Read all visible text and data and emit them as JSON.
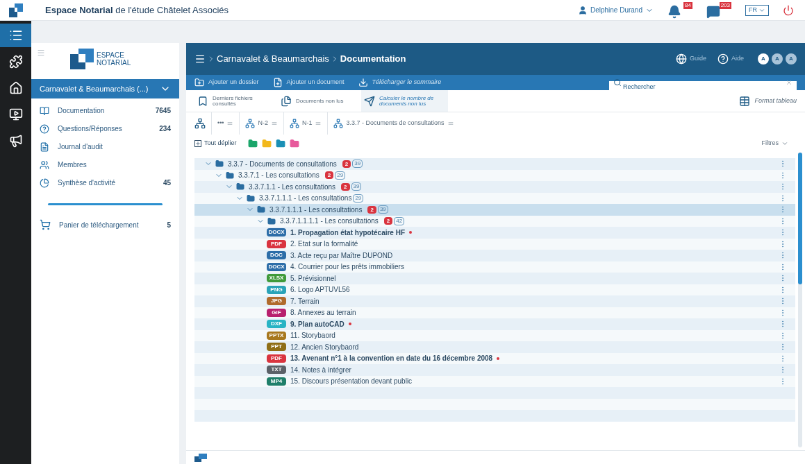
{
  "topbar": {
    "title": "**Espace Notarial** de l'étude Châtelet Associés",
    "user": "Delphine Durand",
    "notifications": "84",
    "messages": "203",
    "language": "FR"
  },
  "rail": [
    {
      "kind": "list",
      "selected": true
    },
    {
      "kind": "puzzle",
      "selected": false
    },
    {
      "kind": "home",
      "selected": false
    },
    {
      "kind": "screen",
      "selected": false
    },
    {
      "kind": "megaphone",
      "selected": false
    }
  ],
  "sidebar": {
    "logo": [
      "ESPACE",
      "NOTARIAL"
    ],
    "workspace": "Carnavalet & Beaumarchais (...)",
    "items": [
      {
        "kind": "book",
        "label": "Documentation",
        "count": "7645"
      },
      {
        "kind": "question",
        "label": "Questions/Réponses",
        "count": "234"
      },
      {
        "kind": "journal",
        "label": "Journal d'audit"
      },
      {
        "kind": "people",
        "label": "Membres"
      },
      {
        "kind": "pie",
        "label": "Synthèse d'activité",
        "count": "45"
      }
    ],
    "cart": {
      "label": "Panier de téléchargement",
      "count": "5"
    }
  },
  "header": {
    "breadcrumb": [
      "Carnavalet & Beaumarchais",
      "Documentation"
    ],
    "guide": "Guide",
    "help": "Aide",
    "text_sizes": [
      {
        "label": "A",
        "selected": true
      },
      {
        "label": "A",
        "selected": false
      },
      {
        "label": "A",
        "selected": false
      }
    ]
  },
  "toolbar": {
    "actions": [
      {
        "kind": "folder-plus",
        "label": "Ajouter un dossier"
      },
      {
        "kind": "file-plus",
        "label": "Ajouter un document"
      },
      {
        "kind": "download",
        "label": "Télécharger le sommaire"
      }
    ],
    "search": {
      "placeholder": "Rechercher"
    }
  },
  "quick": {
    "actions": [
      {
        "kind": "bookmark",
        "label": "Derniers fichiers consultés"
      },
      {
        "kind": "docs",
        "label": "Documents non lus"
      },
      {
        "kind": "plane",
        "label": "Calculer le nombre de documents non lus"
      }
    ],
    "table_format": "Format tableau"
  },
  "path": [
    "•••",
    "N-2",
    "N-1",
    "3.3.7 - Documents de consultations"
  ],
  "expand_all": "Tout déplier",
  "folder_filters": [
    {
      "color": "#1aa56a"
    },
    {
      "color": "#f2b81c"
    },
    {
      "color": "#1a8fb5"
    },
    {
      "color": "#e75a9c"
    }
  ],
  "filters": "Filtres",
  "tree": [
    {
      "kind": "folder",
      "name": "3.3.7 - Documents de consultations",
      "unread": "2",
      "count": "39",
      "expanded": true,
      "selected": false,
      "children": [
        {
          "kind": "folder",
          "name": "3.3.7.1 - Les consultations",
          "unread": "2",
          "count": "29",
          "expanded": true,
          "selected": false,
          "children": [
            {
              "kind": "folder",
              "name": "3.3.7.1.1 - Les consultations",
              "unread": "2",
              "count": "39",
              "expanded": true,
              "selected": false,
              "children": [
                {
                  "kind": "folder",
                  "name": "3.3.7.1.1.1 - Les consultations",
                  "count": "29",
                  "expanded": true,
                  "selected": false,
                  "children": [
                    {
                      "kind": "folder",
                      "name": "3.3.7.1.1.1 - Les consultations",
                      "unread": "2",
                      "count": "39",
                      "expanded": true,
                      "selected": true,
                      "children": [
                        {
                          "kind": "folder",
                          "name": "3.3.7.1.1.1.1 - Les consultations",
                          "unread": "2",
                          "count": "42",
                          "expanded": true,
                          "selected": false,
                          "children": [
                            {
                              "kind": "file",
                              "type": "DOCX",
                              "color": "#2c6da8",
                              "name": "1. Propagation état hypotécaire HF",
                              "unread": true
                            },
                            {
                              "kind": "file",
                              "type": "PDF",
                              "color": "#d9343f",
                              "name": "2. Etat sur la formalité",
                              "unread": false
                            },
                            {
                              "kind": "file",
                              "type": "DOC",
                              "color": "#2c6da8",
                              "name": "3. Acte reçu par Maître DUPOND",
                              "unread": false
                            },
                            {
                              "kind": "file",
                              "type": "DOCX",
                              "color": "#2c6da8",
                              "name": "4. Courrier pour les prêts immobiliers",
                              "unread": false
                            },
                            {
                              "kind": "file",
                              "type": "XLSX",
                              "color": "#3f9a3a",
                              "name": "5. Prévisionnel",
                              "unread": false
                            },
                            {
                              "kind": "file",
                              "type": "PNG",
                              "color": "#2aa3b8",
                              "name": "6. Logo APTUVL56",
                              "unread": false
                            },
                            {
                              "kind": "file",
                              "type": "JPG",
                              "color": "#b06a2c",
                              "name": "7. Terrain",
                              "unread": false
                            },
                            {
                              "kind": "file",
                              "type": "GIF",
                              "color": "#b8206e",
                              "name": "8. Annexes au terrain",
                              "unread": false
                            },
                            {
                              "kind": "file",
                              "type": "DXF",
                              "color": "#27b3c4",
                              "name": "9. Plan autoCAD",
                              "unread": true
                            },
                            {
                              "kind": "file",
                              "type": "PPTX",
                              "color": "#a8781e",
                              "name": "11. Storybaord",
                              "unread": false
                            },
                            {
                              "kind": "file",
                              "type": "PPT",
                              "color": "#8f6e16",
                              "name": "12. Ancien Storybaord",
                              "unread": false
                            },
                            {
                              "kind": "file",
                              "type": "PDF",
                              "color": "#d9343f",
                              "name": "13. Avenant n°1 à la convention en date du 16 décembre 2008",
                              "unread": true
                            },
                            {
                              "kind": "file",
                              "type": "TXT",
                              "color": "#5b6168",
                              "name": "14. Notes à intégrer",
                              "unread": false
                            },
                            {
                              "kind": "file",
                              "type": "MP4",
                              "color": "#1f7f6a",
                              "name": "15. Discours présentation devant public",
                              "unread": false
                            }
                          ]
                        }
                      ]
                    }
                  ]
                }
              ]
            }
          ]
        }
      ]
    }
  ]
}
